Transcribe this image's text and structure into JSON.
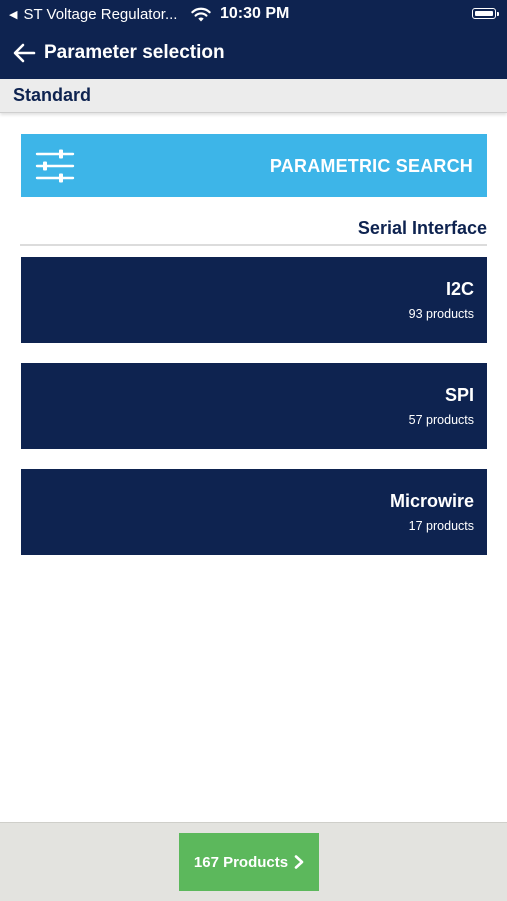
{
  "status_bar": {
    "back_app_label": "ST Voltage Regulator...",
    "time": "10:30 PM"
  },
  "header": {
    "title": "Parameter selection"
  },
  "section": {
    "label": "Standard"
  },
  "search_button": {
    "label": "PARAMETRIC SEARCH",
    "icon": "sliders-icon"
  },
  "group": {
    "title": "Serial Interface",
    "options": [
      {
        "name": "I2C",
        "count": "93 products"
      },
      {
        "name": "SPI",
        "count": "57 products"
      },
      {
        "name": "Microwire",
        "count": "17 products"
      }
    ]
  },
  "footer": {
    "products_label": "167 Products"
  },
  "colors": {
    "navy": "#0e2350",
    "accent_blue": "#3db5e8",
    "green": "#5cb85c",
    "section_gray": "#ececec"
  }
}
